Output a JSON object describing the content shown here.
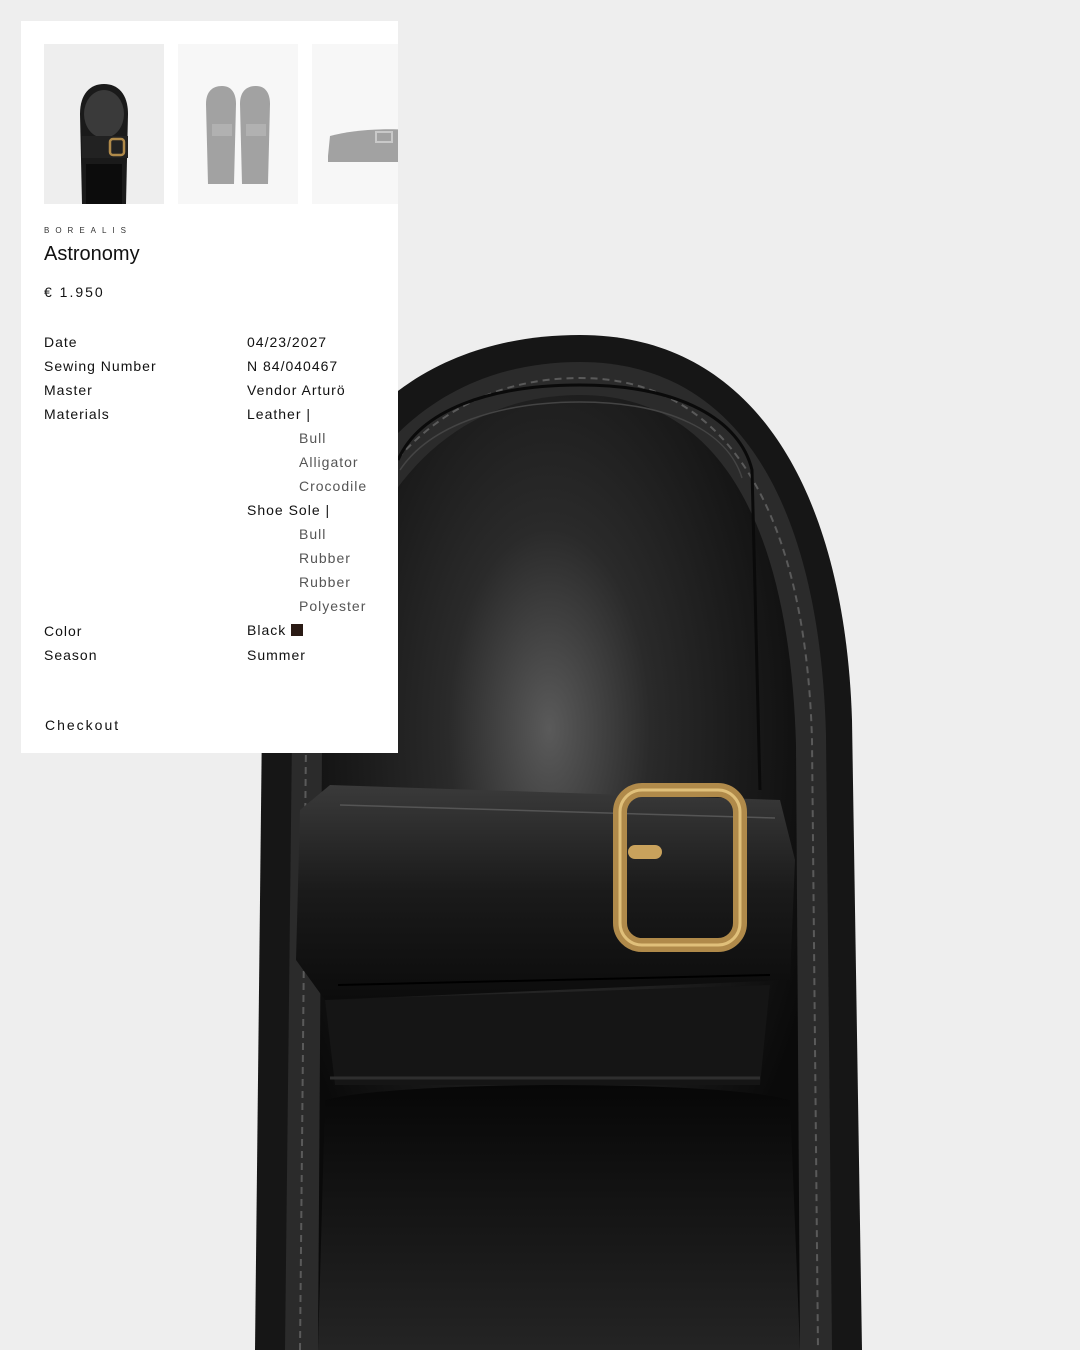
{
  "product": {
    "brand": "BOREALIS",
    "name": "Astronomy",
    "price": "€  1.950",
    "thumbnails": [
      "shoe-top-view",
      "shoe-pair-view",
      "shoe-side-view"
    ]
  },
  "details": {
    "date": {
      "label": "Date",
      "value": "04/23/2027"
    },
    "sewing": {
      "label": "Sewing Number",
      "value": "N 84/040467"
    },
    "master": {
      "label": "Master",
      "value": "Vendor Arturö"
    },
    "materials": {
      "label": "Materials",
      "leather": {
        "label": "Leather |",
        "items": [
          "Bull",
          "Alligator",
          "Crocodile"
        ]
      },
      "sole": {
        "label": "Shoe Sole |",
        "items": [
          "Bull",
          "Rubber",
          "Rubber",
          "Polyester"
        ]
      }
    },
    "color": {
      "label": "Color",
      "value": "Black",
      "swatch": "#2a1a14"
    },
    "season": {
      "label": "Season",
      "value": "Summer"
    }
  },
  "actions": {
    "checkout": "Checkout"
  }
}
